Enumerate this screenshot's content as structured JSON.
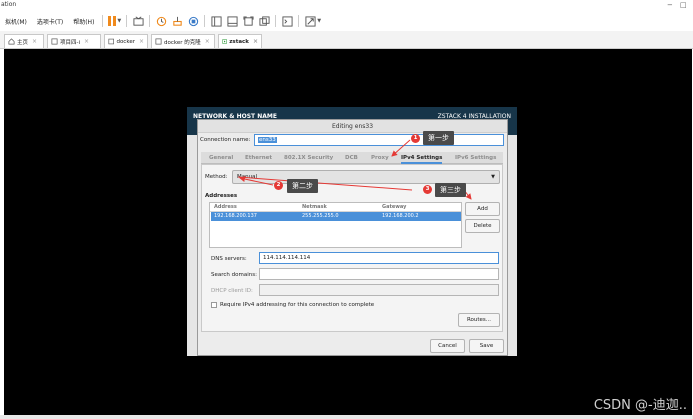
{
  "window": {
    "title": "ation",
    "minimize": "−",
    "restore": "□"
  },
  "menubar": {
    "items": [
      "拟机(M)",
      "选项卡(T)",
      "帮助(H)"
    ]
  },
  "tabs": [
    {
      "label": "主页"
    },
    {
      "label": "项目四-i"
    },
    {
      "label": "docker"
    },
    {
      "label": "docker 的克隆"
    },
    {
      "label": "zstack"
    }
  ],
  "installer": {
    "left_title": "NETWORK & HOST NAME",
    "right_title": "ZSTACK 4 INSTALLATION"
  },
  "dialog": {
    "title": "Editing ens33",
    "connection_name_label": "Connection name:",
    "connection_name_value": "ens33",
    "settings_tabs": [
      "General",
      "Ethernet",
      "802.1X Security",
      "DCB",
      "Proxy",
      "IPv4 Settings",
      "IPv6 Settings"
    ],
    "active_tab": "IPv4 Settings",
    "method_label": "Method:",
    "method_value": "Manual",
    "addresses_label": "Addresses",
    "columns": [
      "Address",
      "Netmask",
      "Gateway"
    ],
    "rows": [
      {
        "address": "192.168.200.137",
        "netmask": "255.255.255.0",
        "gateway": "192.168.200.2"
      }
    ],
    "add_button": "Add",
    "delete_button": "Delete",
    "dns_label": "DNS servers:",
    "dns_value": "114.114.114.114",
    "search_label": "Search domains:",
    "search_value": "",
    "dhcp_label": "DHCP client ID:",
    "dhcp_value": "",
    "require_ipv4_label": "Require IPv4 addressing for this connection to complete",
    "require_ipv4_checked": false,
    "routes_button": "Routes...",
    "cancel_button": "Cancel",
    "save_button": "Save"
  },
  "annotations": [
    {
      "num": "1",
      "text": "第一步"
    },
    {
      "num": "2",
      "text": "第二步"
    },
    {
      "num": "3",
      "text": "第三步"
    }
  ],
  "watermark": "CSDN @-迪迦..",
  "colors": {
    "installer_header": "#173549",
    "selection": "#4a90d9",
    "annotation_red": "#e53935",
    "pause_orange": "#f08a1c"
  }
}
